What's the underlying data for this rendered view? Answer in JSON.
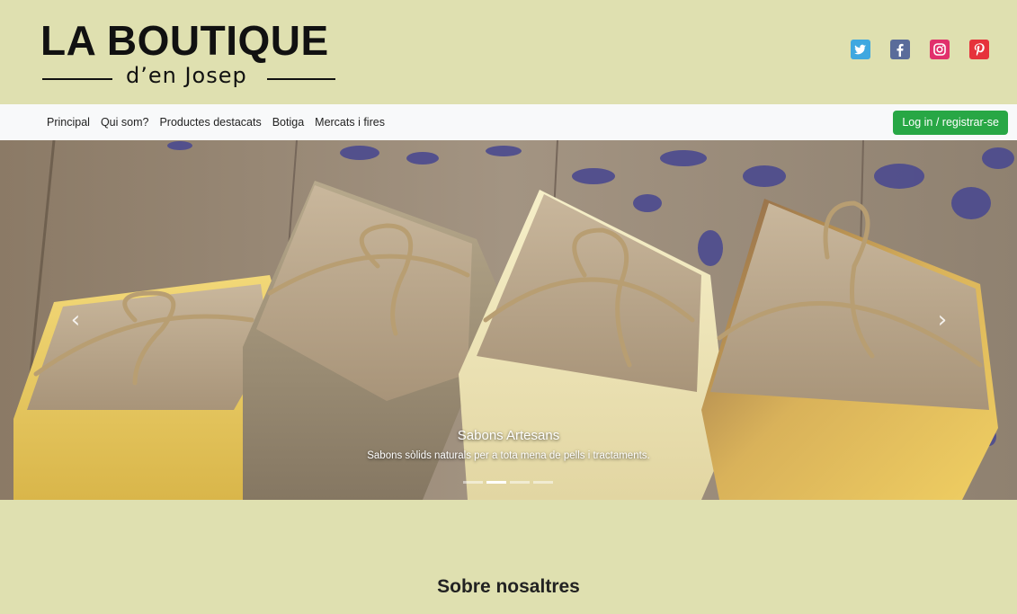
{
  "header": {
    "logo_title": "LA BOUTIQUE",
    "logo_subtitle": "d’en Josep"
  },
  "social": [
    {
      "icon": "twitter-icon",
      "color": "#3fa8e0"
    },
    {
      "icon": "facebook-icon",
      "color": "#5a6c9a"
    },
    {
      "icon": "instagram-icon",
      "color": "#e1306c"
    },
    {
      "icon": "pinterest-icon",
      "color": "#e6323b"
    }
  ],
  "nav": {
    "items": [
      "Principal",
      "Qui som?",
      "Productes destacats",
      "Botiga",
      "Mercats i fires"
    ],
    "login_label": "Log in / registrar-se",
    "login_color": "#28a745"
  },
  "carousel": {
    "prev_icon": "chevron-left-icon",
    "next_icon": "chevron-right-icon",
    "caption_title": "Sabons Artesans",
    "caption_text": "Sabons sòlids naturals per a tota mena de pells i tractaments.",
    "slide_count": 4,
    "active_slide": 2
  },
  "section": {
    "title": "Sobre nosaltres"
  },
  "colors": {
    "page_background": "#dfe0b0",
    "navbar_background": "#f8f9fa"
  }
}
